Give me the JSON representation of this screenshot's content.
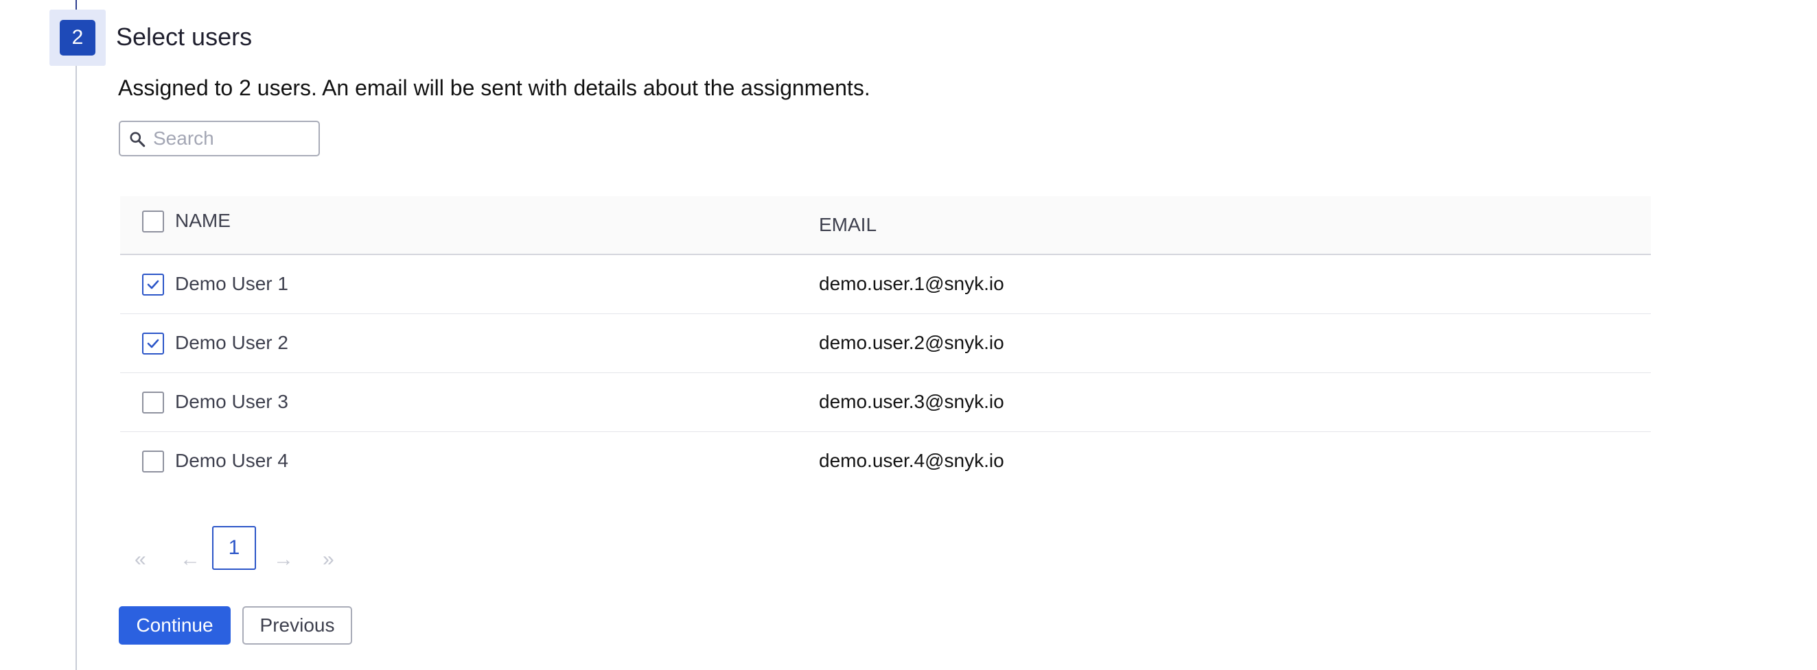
{
  "step": {
    "number": "2",
    "title": "Select users"
  },
  "subtitle": "Assigned to 2 users. An email will be sent with details about the assignments.",
  "search": {
    "placeholder": "Search",
    "value": ""
  },
  "table": {
    "columns": {
      "name": "NAME",
      "email": "EMAIL"
    },
    "rows": [
      {
        "name": "Demo User 1",
        "email": "demo.user.1@snyk.io",
        "checked": true
      },
      {
        "name": "Demo User 2",
        "email": "demo.user.2@snyk.io",
        "checked": true
      },
      {
        "name": "Demo User 3",
        "email": "demo.user.3@snyk.io",
        "checked": false
      },
      {
        "name": "Demo User 4",
        "email": "demo.user.4@snyk.io",
        "checked": false
      }
    ]
  },
  "pagination": {
    "first": "«",
    "prev": "←",
    "current": "1",
    "next": "→",
    "last": "»"
  },
  "buttons": {
    "continue": "Continue",
    "previous": "Previous"
  },
  "colors": {
    "accent": "#2b61e0",
    "step_badge": "#1e4ab8",
    "step_badge_bg": "#e3e8f8"
  },
  "icons": {
    "search": "search-icon",
    "check": "checkmark-icon"
  }
}
